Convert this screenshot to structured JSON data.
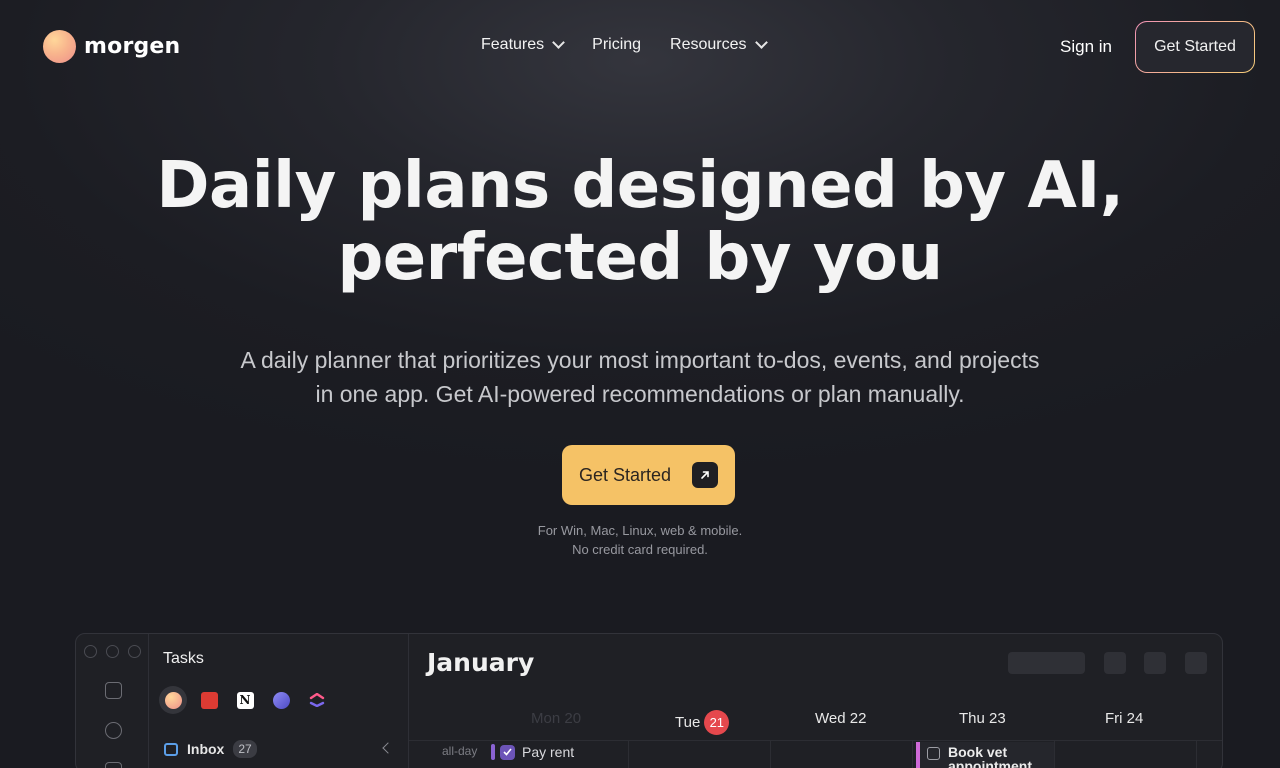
{
  "brand": {
    "name": "morgen"
  },
  "nav": {
    "items": [
      {
        "label": "Features",
        "has_dropdown": true
      },
      {
        "label": "Pricing",
        "has_dropdown": false
      },
      {
        "label": "Resources",
        "has_dropdown": true
      }
    ],
    "signin": "Sign in",
    "cta": "Get Started"
  },
  "hero": {
    "headline_line1": "Daily plans designed by AI,",
    "headline_line2": "perfected by you",
    "subtitle_line1": "A daily planner that prioritizes your most important to-dos, events, and projects",
    "subtitle_line2": "in one app. Get AI-powered recommendations or plan manually.",
    "cta": "Get Started",
    "note_line1": "For Win, Mac, Linux, web & mobile.",
    "note_line2": "No credit card required."
  },
  "app_preview": {
    "tasks_title": "Tasks",
    "integrations": [
      "morgen-icon",
      "todoist-icon",
      "notion-icon",
      "linear-icon",
      "clickup-icon"
    ],
    "inbox_label": "Inbox",
    "inbox_count": "27",
    "month": "January",
    "days": [
      {
        "label": "Mon 20",
        "dim": true
      },
      {
        "label": "Tue",
        "today": "21"
      },
      {
        "label": "Wed 22"
      },
      {
        "label": "Thu 23"
      },
      {
        "label": "Fri 24"
      }
    ],
    "allday_label": "all-day",
    "event_pay_rent": "Pay rent",
    "event_vet_line1": "Book vet",
    "event_vet_line2": "appointment"
  },
  "colors": {
    "accent": "#f5c266",
    "background": "#1c1d23",
    "today_badge": "#e5484d",
    "event_purple": "#8a63d2",
    "event_pink": "#d06ad8"
  }
}
